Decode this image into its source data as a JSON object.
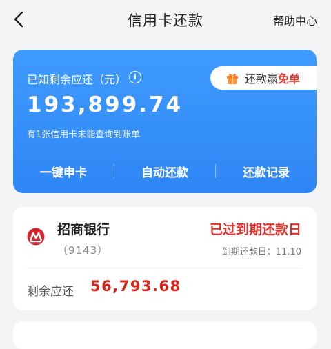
{
  "header": {
    "title": "信用卡还款",
    "help": "帮助中心"
  },
  "summary": {
    "label": "已知剩余应还（元）",
    "info_glyph": "i",
    "amount": "193,899.74",
    "note": "有1张信用卡未能查询到账单",
    "promo": {
      "text": "还款赢",
      "emphasis": "免单"
    },
    "actions": [
      "一键申卡",
      "自动还款",
      "还款记录"
    ]
  },
  "cards": [
    {
      "bank": "招商银行",
      "tail": "（9143）",
      "status": "已过到期还款日",
      "due": "到期还款日：11.10",
      "remain_label": "剩余应还",
      "remain_amount": "56,793.68"
    }
  ],
  "colors": {
    "accent": "#2e86f5",
    "alert": "#e0312c",
    "amount": "#d9261c"
  },
  "icons": {
    "back": "chevron-left-icon",
    "info": "info-icon",
    "gift": "gift-icon",
    "bank": "cmb-logo-icon"
  }
}
